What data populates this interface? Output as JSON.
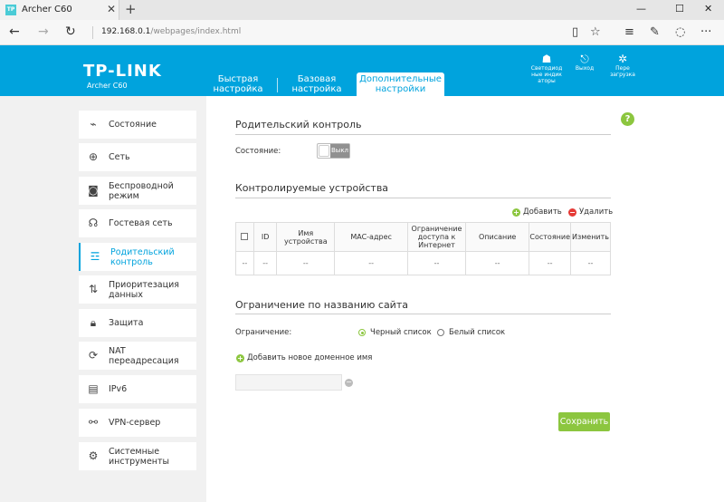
{
  "browser": {
    "tab_title": "Archer C60",
    "tab_favicon": "TP",
    "url_host": "192.168.0.1",
    "url_path": "/webpages/index.html"
  },
  "header": {
    "logo": "TP-LINK",
    "model": "Archer C60",
    "nav": [
      "Быстрая настройка",
      "Базовая настройка",
      "Дополнительные настройки"
    ],
    "icons": [
      {
        "name": "led-icon",
        "label": "Светодиод ные индик аторы"
      },
      {
        "name": "logout-icon",
        "label": "Выход"
      },
      {
        "name": "reboot-icon",
        "label": "Пере загрузка"
      }
    ]
  },
  "sidebar": {
    "items": [
      {
        "label": "Состояние",
        "icon": "status-icon"
      },
      {
        "label": "Сеть",
        "icon": "globe-icon"
      },
      {
        "label": "Беспроводной режим",
        "icon": "wireless-icon"
      },
      {
        "label": "Гостевая сеть",
        "icon": "guest-network-icon"
      },
      {
        "label": "Родительский контроль",
        "icon": "parental-control-icon"
      },
      {
        "label": "Приоритезация данных",
        "icon": "qos-icon"
      },
      {
        "label": "Защита",
        "icon": "lock-icon"
      },
      {
        "label": "NAT переадресация",
        "icon": "nat-icon"
      },
      {
        "label": "IPv6",
        "icon": "ipv6-icon"
      },
      {
        "label": "VPN-сервер",
        "icon": "vpn-icon"
      },
      {
        "label": "Системные инструменты",
        "icon": "gear-icon"
      }
    ],
    "active_index": 4
  },
  "parental": {
    "title": "Родительский контроль",
    "status_label": "Состояние:",
    "toggle_state": "Выкл"
  },
  "devices": {
    "title": "Контролируемые устройства",
    "add_label": "Добавить",
    "delete_label": "Удалить",
    "columns": [
      "",
      "ID",
      "Имя устройства",
      "MAC-адрес",
      "Ограничение доступа к Интернет",
      "Описание",
      "Состояние",
      "Изменить"
    ],
    "rows": [
      [
        "--",
        "--",
        "--",
        "--",
        "--",
        "--",
        "--",
        "--"
      ]
    ]
  },
  "site_limit": {
    "title": "Ограничение по названию сайта",
    "limit_label": "Ограничение:",
    "blacklist_label": "Черный список",
    "whitelist_label": "Белый список",
    "selected": "blacklist",
    "add_domain_label": "Добавить новое доменное имя",
    "domain_value": ""
  },
  "save_label": "Сохранить",
  "colors": {
    "brand": "#00a3dd",
    "accent_green": "#8cc63f",
    "danger_red": "#e53935"
  }
}
